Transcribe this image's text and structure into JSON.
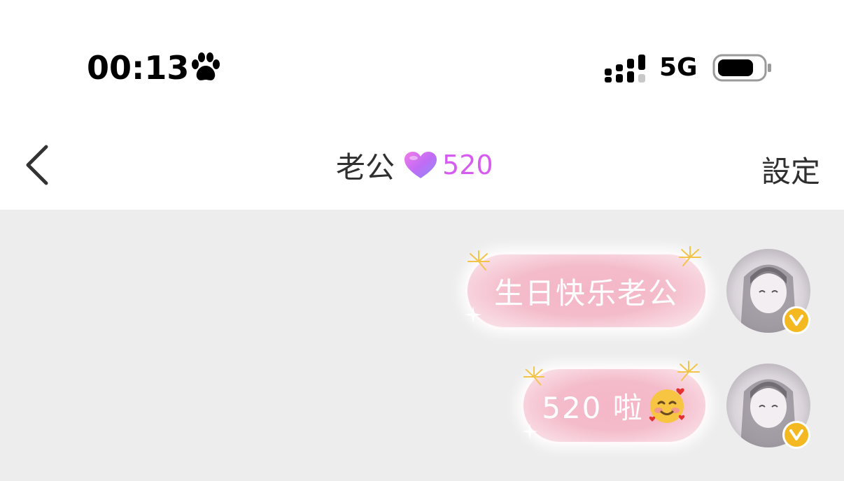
{
  "status_bar": {
    "time": "00:13",
    "network": "5G",
    "icons": [
      "paw-icon",
      "signal-icon",
      "battery-icon"
    ]
  },
  "nav": {
    "back_icon": "chevron-left-icon",
    "title": "老公",
    "heart_icon": "heart-icon",
    "intimacy_value": "520",
    "settings_label": "設定"
  },
  "messages": [
    {
      "text": "生日快乐老公",
      "sender": "self"
    },
    {
      "text": "520 啦",
      "emoji": "smiling-face-with-hearts-icon",
      "sender": "self"
    }
  ],
  "colors": {
    "intimacy": "#d65cf0",
    "chat_background": "#ededed",
    "bubble": "#f4b6c7",
    "vip_badge": "#f4b820"
  }
}
